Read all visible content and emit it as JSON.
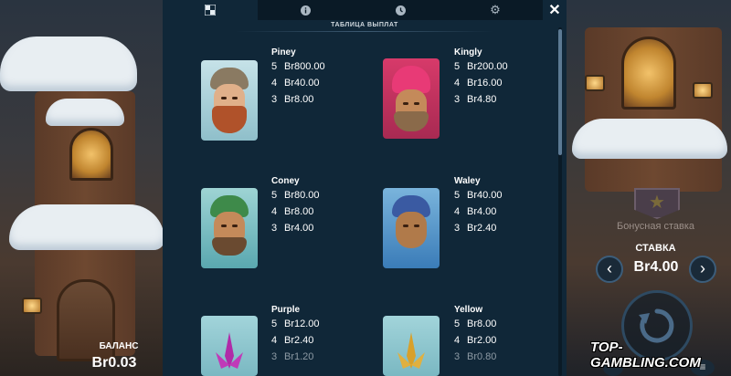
{
  "tabs": [
    {
      "icon": "paytable-icon"
    },
    {
      "icon": "info-icon"
    },
    {
      "icon": "history-icon"
    },
    {
      "icon": "settings-icon"
    }
  ],
  "close_label": "✕",
  "section_title": "ТАБЛИЦА ВЫПЛАТ",
  "symbols": [
    {
      "name": "Piney",
      "pays": [
        {
          "n": "5",
          "v": "Br800.00"
        },
        {
          "n": "4",
          "v": "Br40.00"
        },
        {
          "n": "3",
          "v": "Br8.00"
        }
      ]
    },
    {
      "name": "Kingly",
      "pays": [
        {
          "n": "5",
          "v": "Br200.00"
        },
        {
          "n": "4",
          "v": "Br16.00"
        },
        {
          "n": "3",
          "v": "Br4.80"
        }
      ]
    },
    {
      "name": "Coney",
      "pays": [
        {
          "n": "5",
          "v": "Br80.00"
        },
        {
          "n": "4",
          "v": "Br8.00"
        },
        {
          "n": "3",
          "v": "Br4.00"
        }
      ]
    },
    {
      "name": "Waley",
      "pays": [
        {
          "n": "5",
          "v": "Br40.00"
        },
        {
          "n": "4",
          "v": "Br4.00"
        },
        {
          "n": "3",
          "v": "Br2.40"
        }
      ]
    },
    {
      "name": "Purple",
      "pays": [
        {
          "n": "5",
          "v": "Br12.00"
        },
        {
          "n": "4",
          "v": "Br2.40"
        },
        {
          "n": "3",
          "v": "Br1.20"
        }
      ]
    },
    {
      "name": "Yellow",
      "pays": [
        {
          "n": "5",
          "v": "Br8.00"
        },
        {
          "n": "4",
          "v": "Br2.00"
        },
        {
          "n": "3",
          "v": "Br0.80"
        }
      ]
    }
  ],
  "game_ui": {
    "bonus_label": "Бонусная ставка",
    "stake_label": "СТАВКА",
    "stake_value": "Br4.00",
    "balance_label": "БАЛАНС",
    "balance_value": "Br0.03",
    "prev_label": "‹",
    "next_label": "›",
    "menu_label": "≡"
  },
  "watermark": "TOP-GAMBLING.COM",
  "colors": {
    "modal_bg": "#102738",
    "tab_inactive": "#0a1a26",
    "accent_border": "#3c5d7a"
  }
}
